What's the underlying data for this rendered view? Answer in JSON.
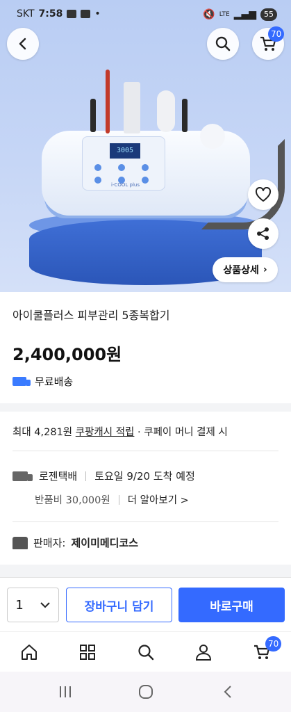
{
  "status_bar": {
    "carrier": "SKT",
    "time": "7:58",
    "network": "LTE",
    "battery": "55"
  },
  "header": {
    "cart_count": "70"
  },
  "hero": {
    "device_display": "3005",
    "device_brand": "i-COOL plus",
    "detail_button_label": "상품상세",
    "detail_chevron": "›"
  },
  "product": {
    "title": "아이쿨플러스 피부관리 5종복합기",
    "price": "2,400,000원",
    "free_shipping": "무료배송"
  },
  "cash": {
    "prefix": "최대 4,281원",
    "link": "쿠팡캐시 적립",
    "suffix": "· 쿠페이 머니 결제 시"
  },
  "delivery": {
    "carrier": "로젠택배",
    "eta": "토요일 9/20 도착 예정",
    "return_fee": "반품비 30,000원",
    "more": "더 알아보기 >"
  },
  "seller": {
    "label": "판매자:",
    "name": "제이미메디코스"
  },
  "purchase_bar": {
    "quantity": "1",
    "add_to_cart": "장바구니 담기",
    "buy_now": "바로구매"
  },
  "bottom_nav": {
    "cart_count": "70"
  },
  "colors": {
    "accent": "#346aff",
    "hero_bg": "#c6d6f6"
  }
}
